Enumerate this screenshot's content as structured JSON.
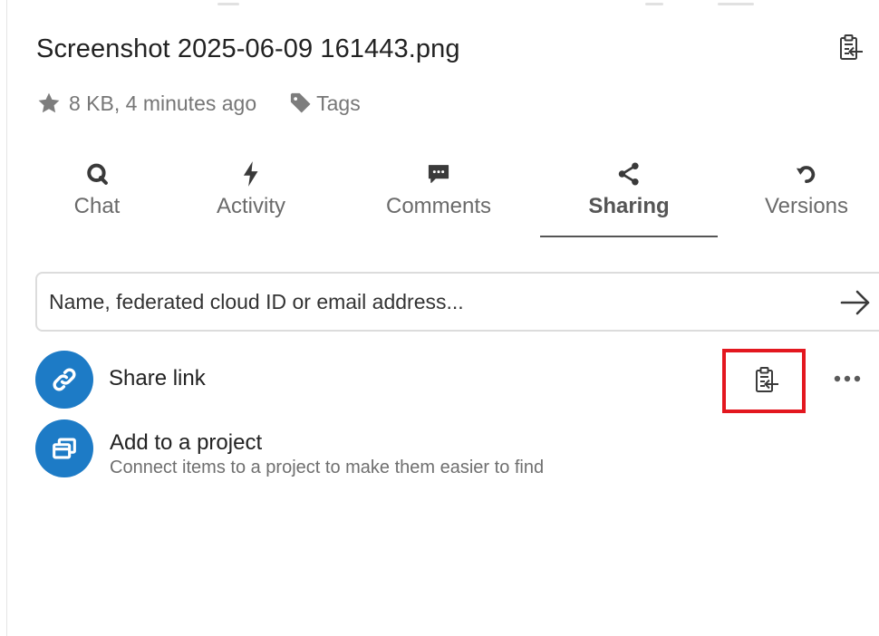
{
  "file": {
    "name": "Screenshot 2025-06-09 161443.png",
    "meta": "8 KB, 4 minutes ago",
    "tags_label": "Tags"
  },
  "icons": {
    "title_action": "clipboard-paste-icon",
    "favorite": "star-icon",
    "tags": "tag-icon",
    "submit": "arrow-right-icon",
    "share_link": "link-icon",
    "copy_link": "clipboard-paste-icon",
    "more": "more-horizontal-icon",
    "project": "window-stack-icon"
  },
  "tabs": [
    {
      "label": "Chat",
      "icon": "chat-icon",
      "active": false
    },
    {
      "label": "Activity",
      "icon": "lightning-icon",
      "active": false
    },
    {
      "label": "Comments",
      "icon": "comment-icon",
      "active": false
    },
    {
      "label": "Sharing",
      "icon": "share-icon",
      "active": true
    },
    {
      "label": "Versions",
      "icon": "history-icon",
      "active": false
    }
  ],
  "sharing": {
    "search_placeholder": "Name, federated cloud ID or email address...",
    "search_value": "",
    "share_link_label": "Share link",
    "project_title": "Add to a project",
    "project_subtitle": "Connect items to a project to make them easier to find"
  },
  "colors": {
    "accent_blue": "#1d7bc6",
    "highlight_red": "#e3171f",
    "text_primary": "#222222",
    "text_muted": "#767676",
    "icon_dark": "#3a3a3a"
  }
}
